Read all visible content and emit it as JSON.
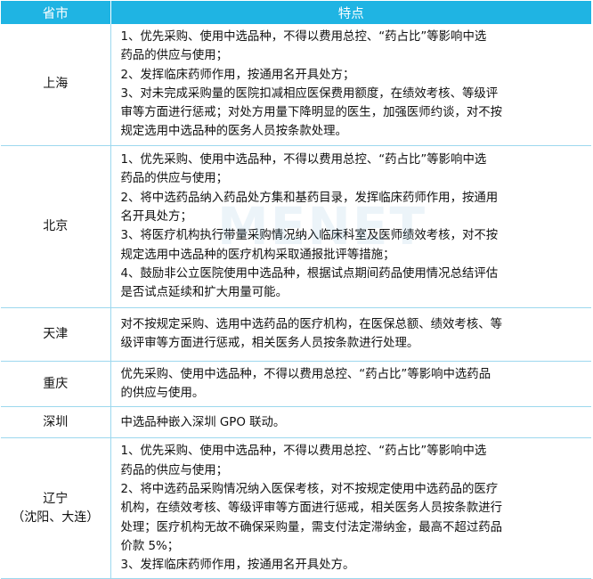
{
  "header": {
    "city": "省市",
    "features": "特点"
  },
  "watermark": "MENET",
  "rows": [
    {
      "city": "上海",
      "lines": [
        "1、优先采购、使用中选品种，不得以费用总控、“药占比”等影响中选",
        "药品的供应与使用；",
        "2、发挥临床药师作用，按通用名开具处方；",
        "3、对未完成采购量的医院扣减相应医保费用额度，在绩效考核、等级评",
        "审等方面进行惩戒；对处方用量下降明显的医生，加强医师约谈，对不按",
        "规定选用中选品种的医务人员按条款处理。"
      ]
    },
    {
      "city": "北京",
      "lines": [
        "1、优先采购、使用中选品种，不得以费用总控、“药占比”等影响中选",
        "药品的供应与使用；",
        "2、将中选药品纳入药品处方集和基药目录，发挥临床药师作用，按通用",
        "名开具处方；",
        "3、将医疗机构执行带量采购情况纳入临床科室及医师绩效考核，对不按",
        "规定选用中选品种的医疗机构采取通报批评等措施；",
        "4、鼓励非公立医院使用中选品种，根据试点期间药品使用情况总结评估",
        "是否试点延续和扩大用量可能。"
      ]
    },
    {
      "city": "天津",
      "lines": [
        "对不按规定采购、选用中选药品的医疗机构，在医保总额、绩效考核、等",
        "级评审等方面进行惩戒，相关医务人员按条款进行处理。"
      ]
    },
    {
      "city": "重庆",
      "lines": [
        "优先采购、使用中选品种，不得以费用总控、“药占比”等影响中选药品",
        "的供应与使用。"
      ]
    },
    {
      "city": "深圳",
      "lines": [
        "中选品种嵌入深圳 GPO 联动。"
      ]
    },
    {
      "city": "辽宁",
      "city_sub": "（沈阳、大连）",
      "lines": [
        "1、优先采购、使用中选品种，不得以费用总控、“药占比”等影响中选",
        "药品的供应与使用；",
        "2、将中选药品采购情况纳入医保考核，对不按规定使用中选药品的医疗",
        "机构，在绩效考核、等级评审等方面进行惩戒，相关医务人员按条款进行",
        "处理；医疗机构无故不确保采购量，需支付法定滞纳金，最高不超过药品",
        "价款 5%；",
        "3、发挥临床药师作用，按通用名开具处方。"
      ]
    }
  ]
}
